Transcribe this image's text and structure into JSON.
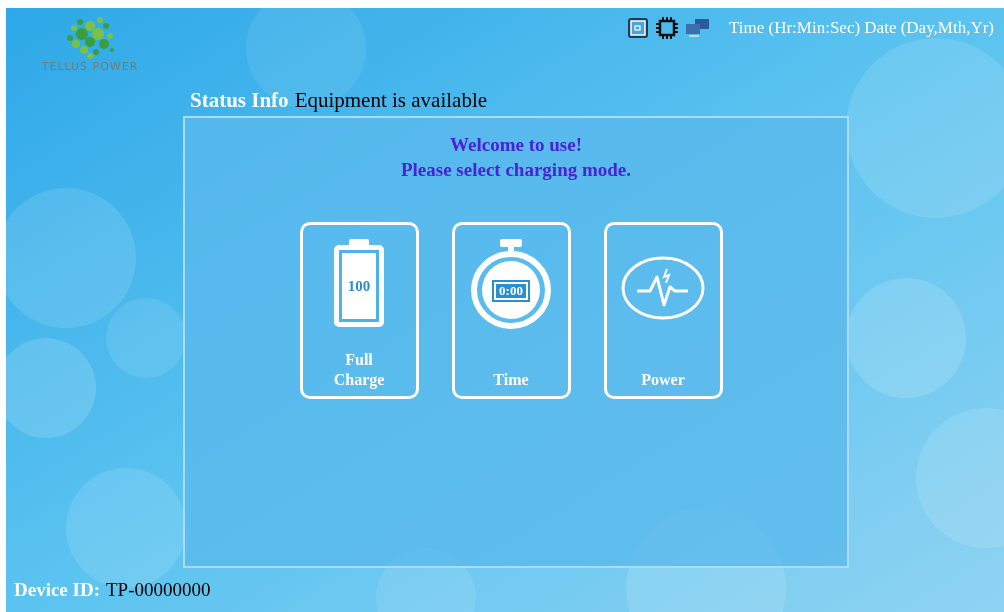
{
  "logo": {
    "text": "TELLUS POWER"
  },
  "header": {
    "datetime": "Time (Hr:Min:Sec) Date (Day,Mth,Yr)"
  },
  "status": {
    "label": "Status Info",
    "value": "Equipment is available"
  },
  "welcome": [
    "Welcome to use!",
    "Please select charging mode."
  ],
  "modes": [
    {
      "kind": "battery",
      "label": "Full Charge",
      "icon_text": "100"
    },
    {
      "kind": "timer",
      "label": "Time",
      "icon_text": "0:00"
    },
    {
      "kind": "power",
      "label": "Power"
    }
  ],
  "device": {
    "label": "Device ID:",
    "value": "TP-00000000"
  }
}
